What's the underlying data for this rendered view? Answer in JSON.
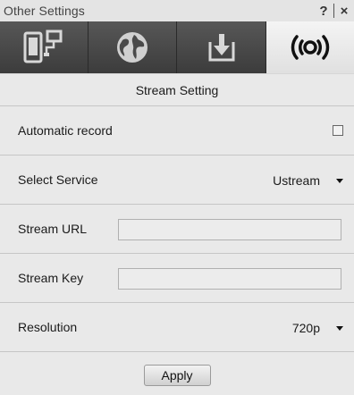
{
  "window": {
    "title": "Other Settings",
    "help_label": "?",
    "close_label": "×"
  },
  "tabs": [
    {
      "icon": "devices-icon",
      "active": false
    },
    {
      "icon": "globe-icon",
      "active": false
    },
    {
      "icon": "download-icon",
      "active": false
    },
    {
      "icon": "broadcast-icon",
      "active": true
    }
  ],
  "section": {
    "title": "Stream Setting"
  },
  "settings": {
    "automatic_record": {
      "label": "Automatic record",
      "checked": false
    },
    "select_service": {
      "label": "Select Service",
      "value": "Ustream"
    },
    "stream_url": {
      "label": "Stream URL",
      "value": ""
    },
    "stream_key": {
      "label": "Stream Key",
      "value": ""
    },
    "resolution": {
      "label": "Resolution",
      "value": "720p"
    }
  },
  "footer": {
    "apply_label": "Apply"
  },
  "colors": {
    "tab_inactive": "#4a4a4a",
    "tab_active": "#eeeeee",
    "background": "#e9e9e9"
  }
}
